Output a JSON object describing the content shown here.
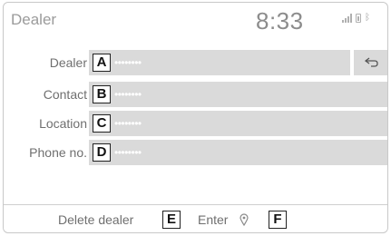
{
  "header": {
    "title": "Dealer",
    "time": "8:33",
    "bluetooth_glyph": "ᛒ"
  },
  "fields": [
    {
      "key": "dealer",
      "label": "Dealer",
      "value": "••••••••",
      "badge": "A"
    },
    {
      "key": "contact",
      "label": "Contact",
      "value": "••••••••",
      "badge": "B"
    },
    {
      "key": "location",
      "label": "Location",
      "value": "••••••••",
      "badge": "C"
    },
    {
      "key": "phone",
      "label": "Phone no.",
      "value": "••••••••",
      "badge": "D"
    }
  ],
  "footer": {
    "delete_label": "Delete dealer",
    "delete_badge": "E",
    "enter_label": "Enter",
    "enter_badge": "F"
  },
  "icons": {
    "back": "back-arrow-icon",
    "enter": "map-pin-icon",
    "signal": "signal-icon",
    "battery": "battery-icon",
    "bluetooth": "bluetooth-icon"
  },
  "colors": {
    "field_bg": "#dadada",
    "label_text": "#6f6f6f",
    "header_text": "#9b9b9b"
  }
}
